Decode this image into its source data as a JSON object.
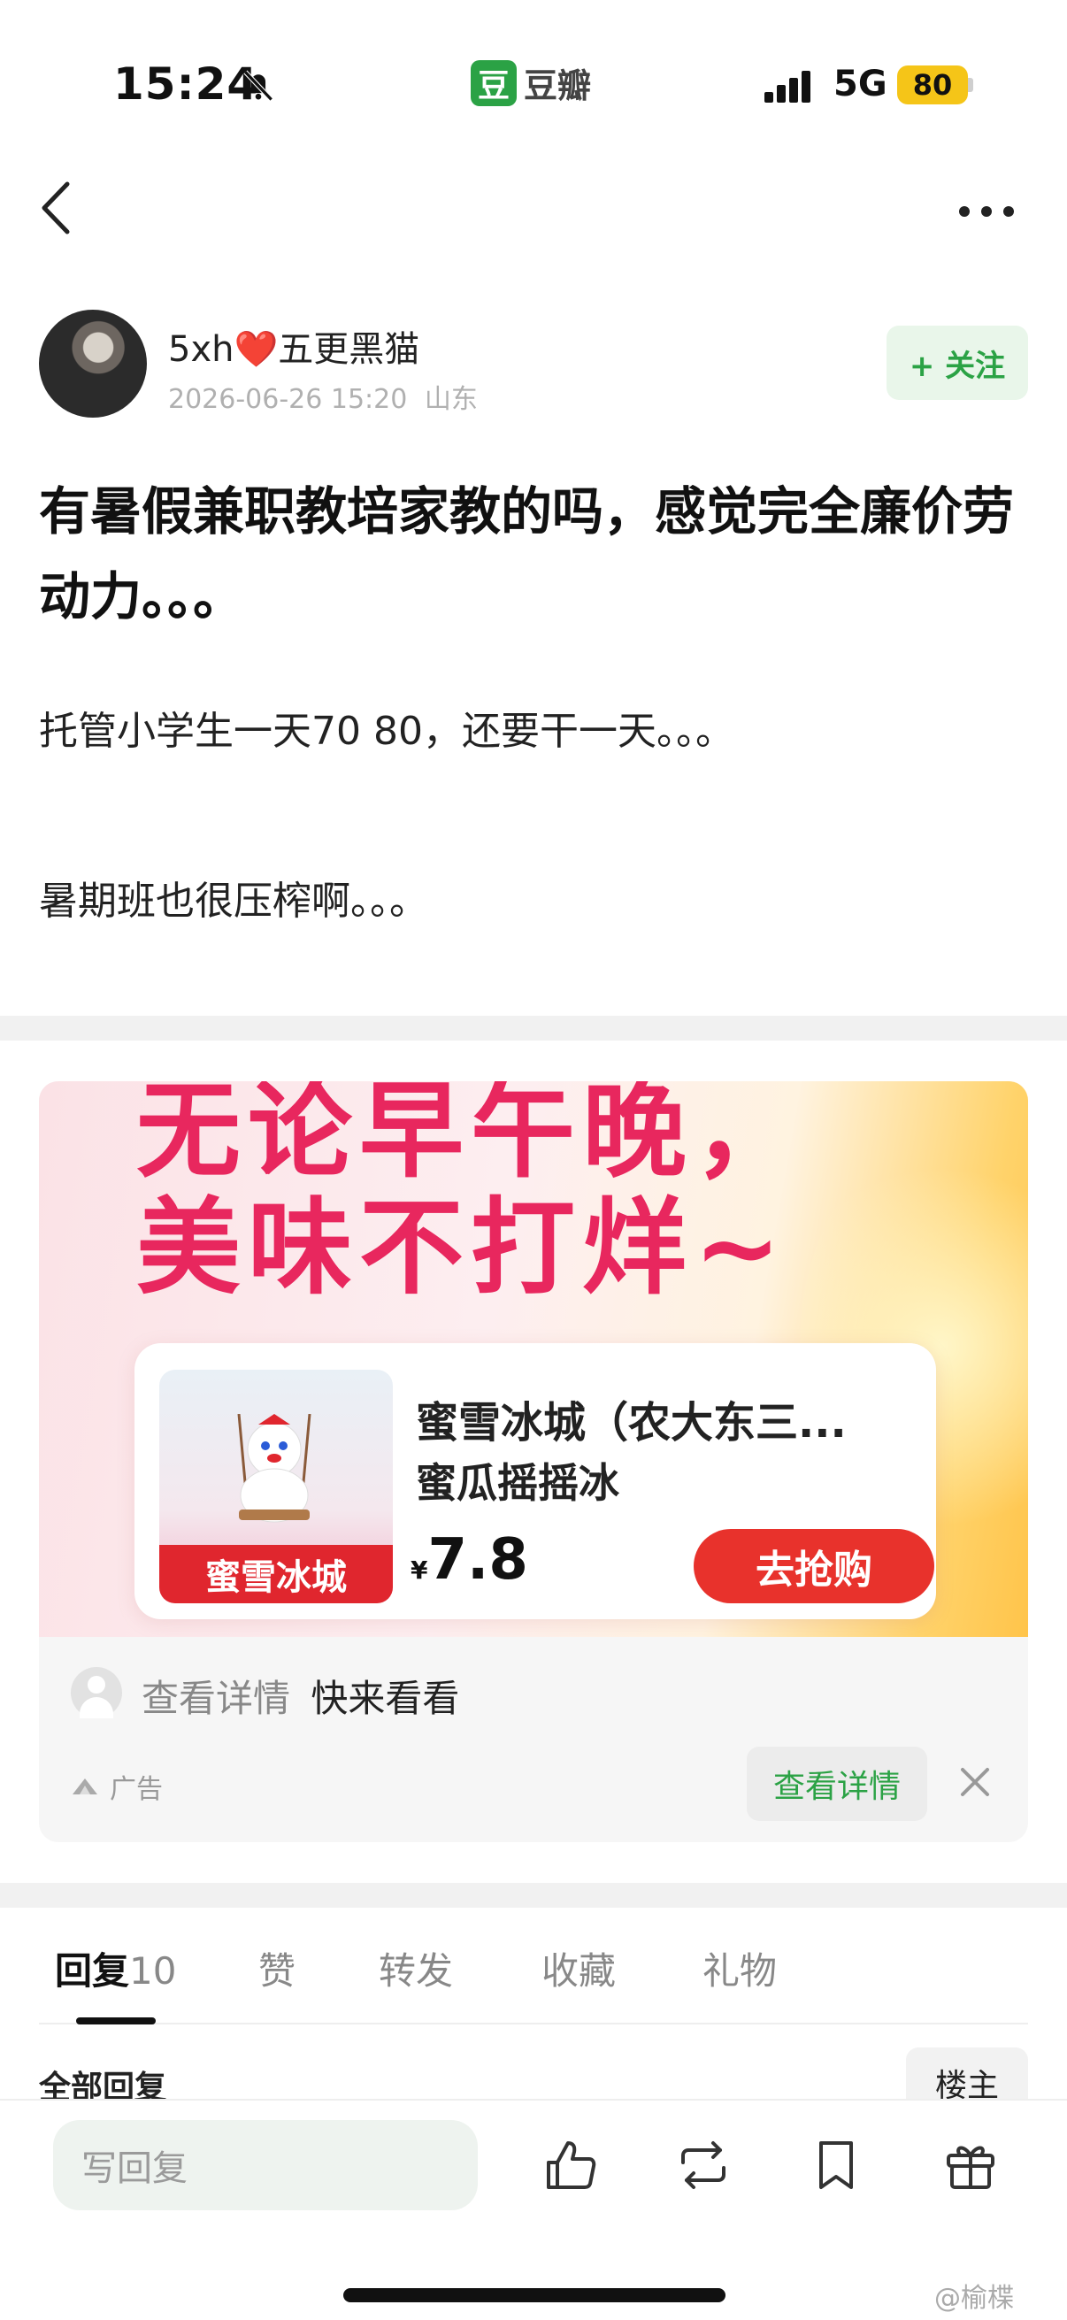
{
  "status_bar": {
    "time": "15:24",
    "app_name": "豆瓣",
    "app_logo_char": "豆",
    "network": "5G",
    "battery": "80"
  },
  "author": {
    "name_prefix": "5xh",
    "heart": "❤️",
    "name_suffix": "五更黑猫",
    "date": "2026-06-26 15:20",
    "location": "山东",
    "follow_label": "+ 关注"
  },
  "post": {
    "title": "有暑假兼职教培家教的吗，感觉完全廉价劳动力。。。",
    "body": [
      "托管小学生一天70  80，还要干一天。。。",
      "暑期班也很压榨啊。。。"
    ]
  },
  "ad": {
    "headline_1": "无论早午晚，",
    "headline_2": "美味不打烊~",
    "shop": "蜜雪冰城（农大东三...",
    "item": "蜜瓜摇摇冰",
    "currency": "¥",
    "price": "7.8",
    "buy_label": "去抢购",
    "brand": "蜜雪冰城",
    "line_muted": "查看详情",
    "line_strong": "快来看看",
    "tag": "广告",
    "detail_button": "查看详情"
  },
  "tabs": [
    {
      "label": "回复",
      "count": "10"
    },
    {
      "label": "赞"
    },
    {
      "label": "转发"
    },
    {
      "label": "收藏"
    },
    {
      "label": "礼物"
    }
  ],
  "replies": {
    "all_label": "全部回复",
    "owner_label": "楼主"
  },
  "bottom_bar": {
    "reply_placeholder": "写回复",
    "icons": [
      "thumbs-up-icon",
      "repost-icon",
      "bookmark-icon",
      "gift-icon"
    ]
  },
  "watermark": "@榆楪",
  "colors": {
    "accent_green": "#2ba245",
    "ad_red": "#e8322c",
    "headline_pink": "#e8275e"
  }
}
